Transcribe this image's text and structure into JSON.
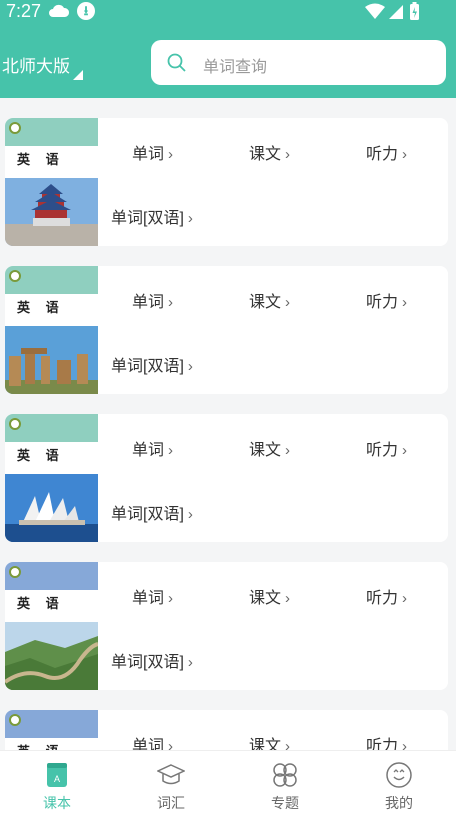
{
  "status": {
    "time": "7:27"
  },
  "header": {
    "edition": "北师大版",
    "search_placeholder": "单词查询"
  },
  "cards": [
    {
      "title": "英 语",
      "links": {
        "words": "单词",
        "text": "课文",
        "listening": "听力",
        "bilingual": "单词[双语]"
      },
      "band_color": "#8fcfbf"
    },
    {
      "title": "英 语",
      "links": {
        "words": "单词",
        "text": "课文",
        "listening": "听力",
        "bilingual": "单词[双语]"
      },
      "band_color": "#8fcfbf"
    },
    {
      "title": "英 语",
      "links": {
        "words": "单词",
        "text": "课文",
        "listening": "听力",
        "bilingual": "单词[双语]"
      },
      "band_color": "#8fcfbf"
    },
    {
      "title": "英 语",
      "links": {
        "words": "单词",
        "text": "课文",
        "listening": "听力",
        "bilingual": "单词[双语]"
      },
      "band_color": "#86a8d8"
    },
    {
      "title": "英 语",
      "links": {
        "words": "单词",
        "text": "课文",
        "listening": "听力"
      },
      "band_color": "#86a8d8"
    }
  ],
  "tabs": [
    {
      "label": "课本",
      "icon": "textbook-icon",
      "active": true
    },
    {
      "label": "词汇",
      "icon": "graduation-cap-icon",
      "active": false
    },
    {
      "label": "专题",
      "icon": "clover-icon",
      "active": false
    },
    {
      "label": "我的",
      "icon": "smiley-face-icon",
      "active": false
    }
  ],
  "colors": {
    "accent": "#46c3aa"
  }
}
